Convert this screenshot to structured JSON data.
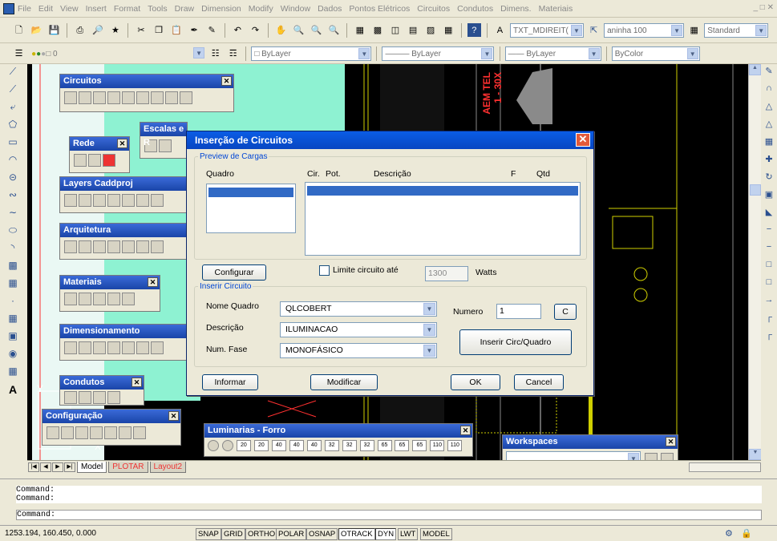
{
  "menu": [
    "File",
    "Edit",
    "View",
    "Insert",
    "Format",
    "Tools",
    "Draw",
    "Dimension",
    "Modify",
    "Window",
    "Dados",
    "Pontos Elétricos",
    "Circuitos",
    "Condutos",
    "Dimens.",
    "Materiais"
  ],
  "toolbar": {
    "text_style": "TXT_MDIREIT(",
    "dim_style": "aninha 100",
    "table_style": "Standard",
    "layer": "0",
    "color": "ByLayer",
    "linetype": "ByLayer",
    "lineweight": "ByLayer",
    "plotstyle": "ByColor"
  },
  "palettes": {
    "circuitos": "Circuitos",
    "escalas": "Escalas e R",
    "rede": "Rede",
    "layers": "Layers Caddproj",
    "arquitetura": "Arquitetura",
    "materiais": "Materiais",
    "dimensionamento": "Dimensionamento",
    "condutos": "Condutos",
    "configuracao": "Configuração",
    "luminarias": "Luminarias - Forro",
    "workspaces": "Workspaces"
  },
  "luminarias_buttons": [
    "20",
    "20",
    "40",
    "40",
    "40",
    "32",
    "32",
    "32",
    "65",
    "65",
    "65",
    "110",
    "110"
  ],
  "drawing_text": {
    "vertical": "AEM TEL",
    "vertical2": "1 - 30X"
  },
  "dialog": {
    "title": "Inserção de Circuitos",
    "preview_group": "Preview de Cargas",
    "col_quadro": "Quadro",
    "col_cir": "Cir.",
    "col_pot": "Pot.",
    "col_desc": "Descrição",
    "col_f": "F",
    "col_qtd": "Qtd",
    "configurar_btn": "Configurar",
    "limite_label": "Limite circuito até",
    "limite_value": "1300",
    "watts_label": "Watts",
    "inserir_group": "Inserir Circuito",
    "nome_quadro_label": "Nome Quadro",
    "nome_quadro_value": "QLCOBERT",
    "descricao_label": "Descrição",
    "descricao_value": "ILUMINACAO",
    "num_fase_label": "Num. Fase",
    "num_fase_value": "MONOFÁSICO",
    "numero_label": "Numero",
    "numero_value": "1",
    "c_btn": "C",
    "inserir_btn": "Inserir Circ/Quadro",
    "informar_btn": "Informar",
    "modificar_btn": "Modificar",
    "ok_btn": "OK",
    "cancel_btn": "Cancel"
  },
  "tabs": [
    "Model",
    "PLOTAR",
    "Layout2"
  ],
  "axis": {
    "y": "Y",
    "x": "X"
  },
  "command_lines": [
    "Command:",
    "Command:",
    "Command:"
  ],
  "status": {
    "coords": "1253.194, 160.450, 0.000",
    "buttons": [
      "SNAP",
      "GRID",
      "ORTHO",
      "POLAR",
      "OSNAP",
      "OTRACK",
      "DYN",
      "LWT",
      "MODEL"
    ]
  }
}
